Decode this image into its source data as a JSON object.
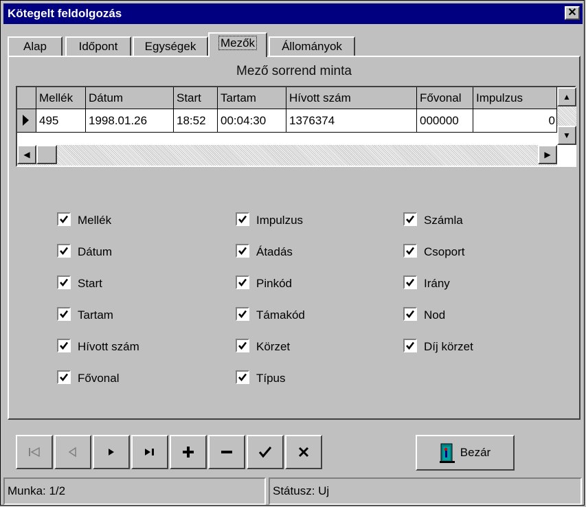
{
  "window": {
    "title": "Kötegelt feldolgozás",
    "close_label": "✕"
  },
  "tabs": [
    {
      "label": "Alap",
      "active": false
    },
    {
      "label": "Időpont",
      "active": false
    },
    {
      "label": "Egységek",
      "active": false
    },
    {
      "label": "Mezők",
      "active": true
    },
    {
      "label": "Állományok",
      "active": false
    }
  ],
  "sample": {
    "caption": "Mező sorrend minta",
    "columns": [
      "Mellék",
      "Dátum",
      "Start",
      "Tartam",
      "Hívott szám",
      "Fővonal",
      "Impulzus"
    ],
    "row": [
      "495",
      "1998.01.26",
      "18:52",
      "00:04:30",
      "1376374",
      "000000",
      "0"
    ]
  },
  "fields": {
    "col1": [
      {
        "label": "Mellék",
        "checked": true
      },
      {
        "label": "Dátum",
        "checked": true
      },
      {
        "label": "Start",
        "checked": true
      },
      {
        "label": "Tartam",
        "checked": true
      },
      {
        "label": "Hívott szám",
        "checked": true
      },
      {
        "label": "Fővonal",
        "checked": true
      }
    ],
    "col2": [
      {
        "label": "Impulzus",
        "checked": true
      },
      {
        "label": "Átadás",
        "checked": true
      },
      {
        "label": "Pinkód",
        "checked": true
      },
      {
        "label": "Támakód",
        "checked": true
      },
      {
        "label": "Körzet",
        "checked": true
      },
      {
        "label": "Típus",
        "checked": true
      }
    ],
    "col3": [
      {
        "label": "Számla",
        "checked": true
      },
      {
        "label": "Csoport",
        "checked": true
      },
      {
        "label": "Irány",
        "checked": true
      },
      {
        "label": "Nod",
        "checked": true
      },
      {
        "label": "Díj körzet",
        "checked": true
      }
    ]
  },
  "navigator": {
    "buttons": [
      {
        "icon": "first-record-icon",
        "enabled": false
      },
      {
        "icon": "prior-record-icon",
        "enabled": false
      },
      {
        "icon": "next-record-icon",
        "enabled": true
      },
      {
        "icon": "last-record-icon",
        "enabled": true
      },
      {
        "icon": "insert-record-icon",
        "enabled": true
      },
      {
        "icon": "delete-record-icon",
        "enabled": true
      },
      {
        "icon": "post-record-icon",
        "enabled": true
      },
      {
        "icon": "cancel-record-icon",
        "enabled": true
      }
    ]
  },
  "close_button": {
    "label": "Bezár",
    "icon": "door-exit-icon",
    "accent": "#008080"
  },
  "statusbar": {
    "left": "Munka: 1/2",
    "right": "Státusz: Uj"
  },
  "colors": {
    "title_bg": "#000080",
    "face": "#c0c0c0"
  }
}
